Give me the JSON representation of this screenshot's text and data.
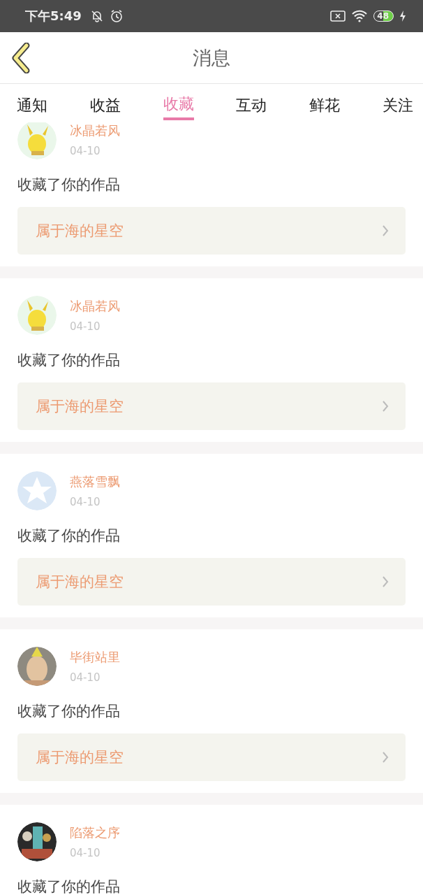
{
  "status_bar": {
    "time": "下午5:49",
    "battery": "48"
  },
  "header": {
    "title": "消息"
  },
  "tabs": [
    {
      "label": "通知",
      "selected": false
    },
    {
      "label": "收益",
      "selected": false
    },
    {
      "label": "收藏",
      "selected": true
    },
    {
      "label": "互动",
      "selected": false
    },
    {
      "label": "鲜花",
      "selected": false
    },
    {
      "label": "关注",
      "selected": false
    }
  ],
  "messages": [
    {
      "user": "冰晶若风",
      "date": "04-10",
      "action": "收藏了你的作品",
      "work": "属于海的星空"
    },
    {
      "user": "冰晶若风",
      "date": "04-10",
      "action": "收藏了你的作品",
      "work": "属于海的星空"
    },
    {
      "user": "燕落雪飘",
      "date": "04-10",
      "action": "收藏了你的作品",
      "work": "属于海的星空"
    },
    {
      "user": "毕街站里",
      "date": "04-10",
      "action": "收藏了你的作品",
      "work": "属于海的星空"
    },
    {
      "user": "陷落之序",
      "date": "04-10",
      "action": "收藏了你的作品"
    }
  ]
}
